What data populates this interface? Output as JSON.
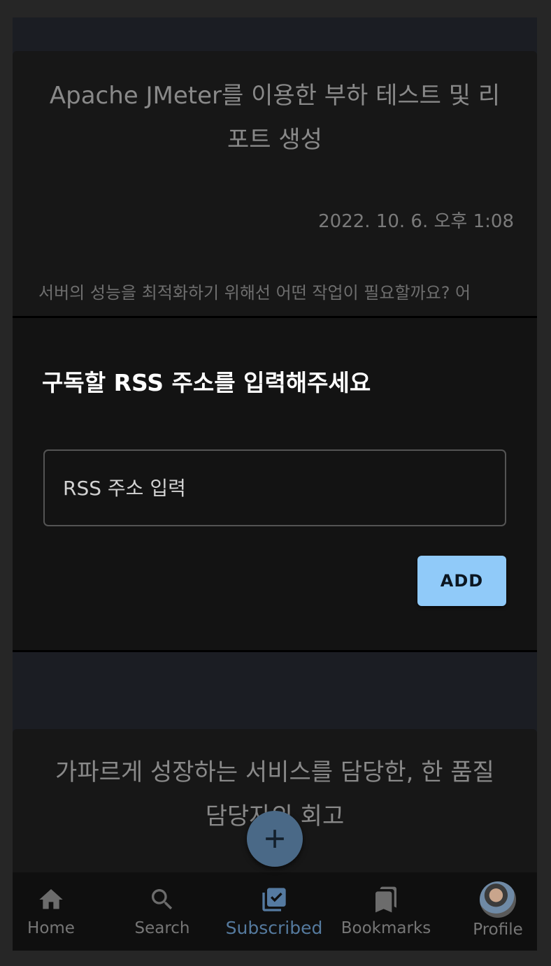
{
  "feed": {
    "cards": [
      {
        "title": "Apache JMeter를 이용한 부하 테스트 및 리포트 생성",
        "date": "2022. 10. 6. 오후 1:08",
        "excerpt": "서버의 성능을 최적화하기 위해선 어떤 작업이 필요할까요? 어"
      },
      {
        "title": "가파르게 성장하는 서비스를 담당한, 한 품질담당자의 회고"
      }
    ]
  },
  "dialog": {
    "title": "구독할 RSS 주소를 입력해주세요",
    "input": {
      "placeholder": "RSS 주소 입력"
    },
    "add_label": "ADD"
  },
  "fab": {
    "icon": "add-icon"
  },
  "bottom_nav": {
    "items": [
      {
        "label": "Home",
        "icon": "home-icon",
        "active": false
      },
      {
        "label": "Search",
        "icon": "search-icon",
        "active": false
      },
      {
        "label": "Subscribed",
        "icon": "library-add-check-icon",
        "active": true
      },
      {
        "label": "Bookmarks",
        "icon": "bookmarks-icon",
        "active": false
      },
      {
        "label": "Profile",
        "icon": "avatar",
        "active": false
      }
    ]
  },
  "colors": {
    "accent": "#90caf9",
    "dialog_background": "#131313",
    "active_nav": "#557aa0"
  }
}
